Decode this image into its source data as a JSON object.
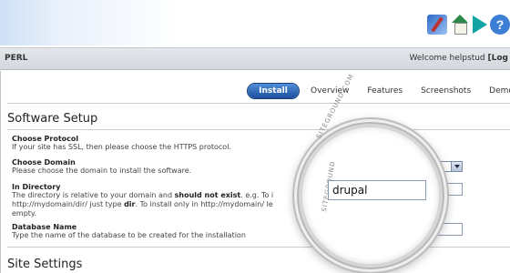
{
  "header": {
    "icons": [
      "tools-icon",
      "home-icon",
      "play-icon",
      "help-icon"
    ],
    "help_glyph": "?"
  },
  "nav": {
    "section": "PERL",
    "welcome_prefix": "Welcome",
    "username": "helpstud",
    "logout_fragment": "[Log"
  },
  "tabs": {
    "active": "Install",
    "items": [
      "Overview",
      "Features",
      "Screenshots",
      "Demo"
    ]
  },
  "software_setup": {
    "heading": "Software Setup",
    "protocol": {
      "label": "Choose Protocol",
      "desc": "If your site has SSL, then please choose the HTTPS protocol."
    },
    "domain": {
      "label": "Choose Domain",
      "desc": "Please choose the domain to install the software."
    },
    "directory": {
      "label": "In Directory",
      "desc_line1_a": "The directory is relative to your domain and ",
      "desc_line1_b": "should not exist",
      "desc_line1_c": ". e.g. To i",
      "desc_line2_a": "http://mydomain/dir/ just type ",
      "desc_line2_b": "dir",
      "desc_line2_c": ". To install only in http://mydomain/ le",
      "desc_line3": "empty.",
      "value": "drupal"
    },
    "database": {
      "label": "Database Name",
      "desc": "Type the name of the database to be created for the installation"
    }
  },
  "site_settings": {
    "heading": "Site Settings"
  },
  "watermark": {
    "top": "SITEGROUND.COM",
    "side": "SITEGROUND"
  },
  "colors": {
    "accent": "#1d4f9e",
    "nav_bg": "#d4d8de"
  }
}
